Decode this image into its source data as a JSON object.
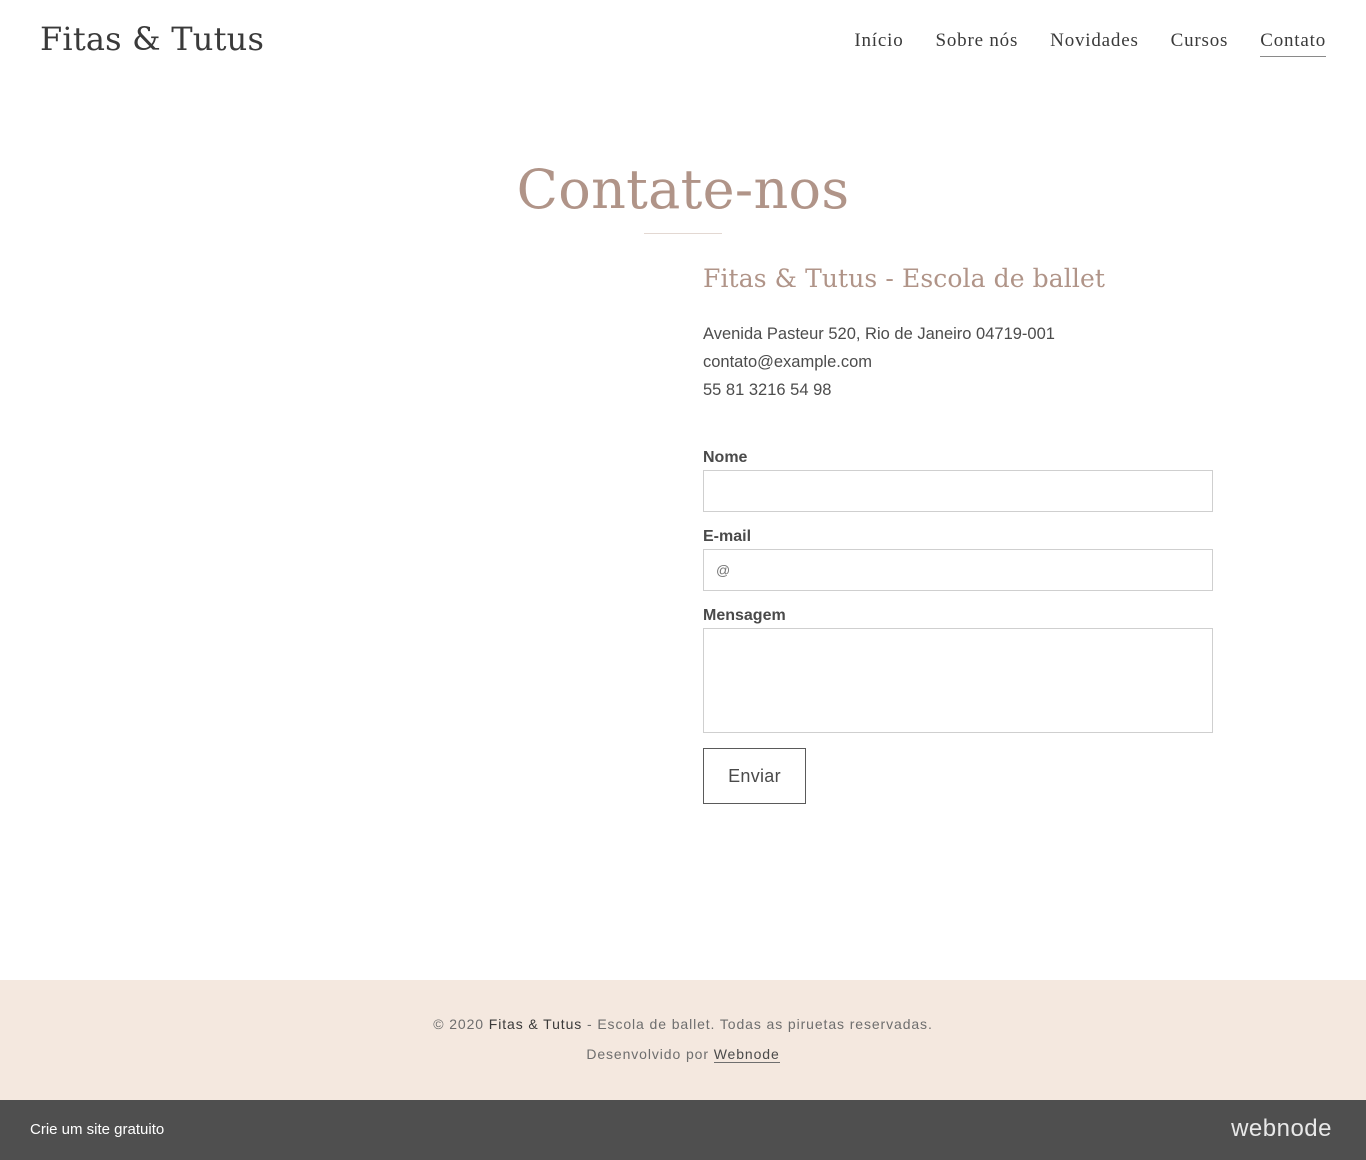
{
  "header": {
    "logo": "Fitas & Tutus",
    "nav": [
      {
        "label": "Início"
      },
      {
        "label": "Sobre nós"
      },
      {
        "label": "Novidades"
      },
      {
        "label": "Cursos"
      },
      {
        "label": "Contato",
        "active": true
      }
    ]
  },
  "main": {
    "title": "Contate-nos",
    "school_name": "Fitas & Tutus - Escola de ballet",
    "address": "Avenida Pasteur 520, Rio de Janeiro 04719-001",
    "email": "contato@example.com",
    "phone": "55 81 3216 54 98"
  },
  "form": {
    "name_label": "Nome",
    "name_value": "",
    "email_label": "E-mail",
    "email_placeholder": "@",
    "message_label": "Mensagem",
    "message_value": "",
    "submit_label": "Enviar"
  },
  "footer": {
    "copyright_prefix": "© 2020",
    "brand": "Fitas & Tutus",
    "copyright_suffix": "- Escola de ballet. Todas as piruetas reservadas.",
    "developed_by": "Desenvolvido por",
    "developer_link": "Webnode"
  },
  "bottom_bar": {
    "cta": "Crie um site gratuito",
    "brand_logo": "webnode"
  },
  "colors": {
    "accent": "#b09488",
    "footer_bg": "#f4e8df",
    "bottom_bar_bg": "#4f4f4f"
  }
}
